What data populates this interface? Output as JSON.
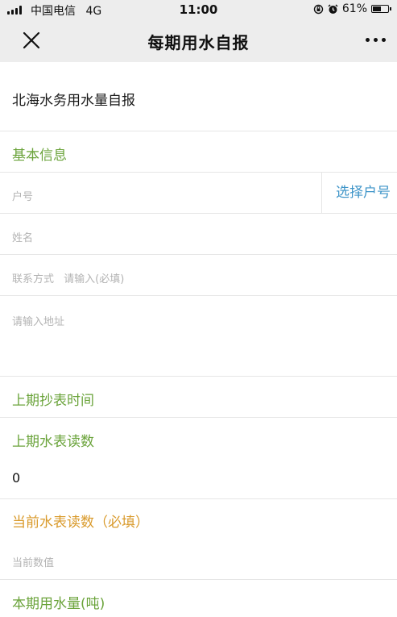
{
  "status_bar": {
    "carrier": "中国电信",
    "network": "4G",
    "time": "11:00",
    "battery_percent": "61%",
    "battery_level": 0.61,
    "icons": [
      "signal-icon",
      "orientation-lock-icon",
      "alarm-icon",
      "battery-icon"
    ]
  },
  "navbar": {
    "title": "每期用水自报",
    "left_icon": "close-icon",
    "right_icon": "more-icon"
  },
  "form": {
    "heading": "北海水务用水量自报",
    "basic_info_label": "基本信息",
    "account_placeholder": "户号",
    "select_account_label": "选择户号",
    "name_placeholder": "姓名",
    "contact_label": "联系方式",
    "contact_placeholder": "请输入(必填)",
    "address_placeholder": "请输入地址",
    "last_read_time_label": "上期抄表时间",
    "last_reading_label": "上期水表读数",
    "last_reading_value": "0",
    "current_reading_label": "当前水表读数（必填）",
    "current_reading_placeholder": "当前数值",
    "usage_label": "本期用水量(吨)"
  },
  "colors": {
    "green": "#6aa33a",
    "orange": "#d99a2b",
    "link_blue": "#3d94c8",
    "bar_gray": "#ededed"
  }
}
